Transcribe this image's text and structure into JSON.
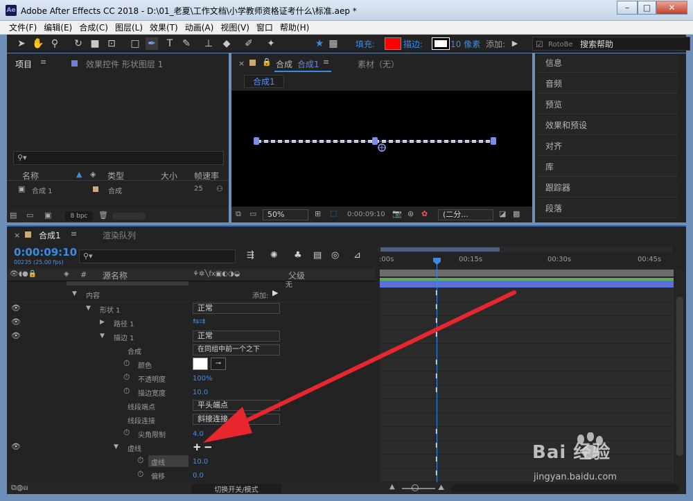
{
  "window": {
    "app_icon": "Ae",
    "title": "Adobe After Effects CC 2018 - D:\\01_老夏\\工作文档\\小学教师资格证考什么\\标准.aep *",
    "controls": [
      "–",
      "□",
      "✕"
    ]
  },
  "menu": [
    "文件(F)",
    "编辑(E)",
    "合成(C)",
    "图层(L)",
    "效果(T)",
    "动画(A)",
    "视图(V)",
    "窗口",
    "帮助(H)"
  ],
  "toolbar": {
    "fill_label": "填充:",
    "stroke_label": "描边:",
    "stroke_width": "10 像素",
    "add_label": "添加:",
    "rotobe_label": "RotoBe",
    "search_help": "搜索帮助",
    "fill_color": "#ff0000",
    "stroke_color": "#ffffff"
  },
  "project_panel": {
    "tab_project": "项目",
    "tab_effects": "效果控件 形状图层 1",
    "col_name": "名称",
    "col_type": "类型",
    "col_size": "大小",
    "col_fps": "帧速率",
    "item_name": "合成 1",
    "item_type": "合成",
    "item_fps": "25",
    "bpc": "8 bpc"
  },
  "comp_panel": {
    "tab_label": "合成",
    "tab_comp": "合成1",
    "footage_tab": "素材（无）",
    "sub_tab": "合成1",
    "zoom": "50%",
    "timecode": "0:00:09:10",
    "resolution": "(二分..."
  },
  "right_panel": [
    "信息",
    "音频",
    "预览",
    "效果和预设",
    "对齐",
    "库",
    "跟踪器",
    "段落"
  ],
  "timeline": {
    "tab_close": "×",
    "tab_comp": "合成1",
    "tab_render": "渲染队列",
    "timecode": "0:00:09:10",
    "frame_info": "00235 (25.00 fps)",
    "col_source": "源名称",
    "col_parent": "父级",
    "col_hash": "#",
    "ruler": [
      ":00s",
      "00:15s",
      "00:30s",
      "00:45s"
    ],
    "parent_none": "无",
    "toggle_label": "切换开关/模式",
    "rows": {
      "contents": "内容",
      "add_label": "添加:",
      "shape1": "形状 1",
      "shape1_mode": "正常",
      "path1": "路径 1",
      "stroke1": "描边 1",
      "stroke1_mode": "正常",
      "composite": "合成",
      "composite_val": "在同组中前一个之下",
      "color": "颜色",
      "opacity": "不透明度",
      "opacity_val": "100%",
      "stroke_width": "描边宽度",
      "stroke_width_val": "10.0",
      "line_cap": "线段端点",
      "line_cap_val": "平头端点",
      "line_join": "线段连接",
      "line_join_val": "斜接连接",
      "miter": "尖角限制",
      "miter_val": "4.0",
      "dashes": "虚线",
      "dash": "虚线",
      "dash_val": "10.0",
      "offset": "偏移",
      "offset_val": "0.0"
    }
  },
  "watermark": {
    "brand": "Bai 经验",
    "url": "jingyan.baidu.com"
  },
  "colors": {
    "accent": "#3d8be0",
    "arrow": "#e8262d",
    "label_blue": "#6a7fe0",
    "comp_label": "#c7a97a"
  }
}
